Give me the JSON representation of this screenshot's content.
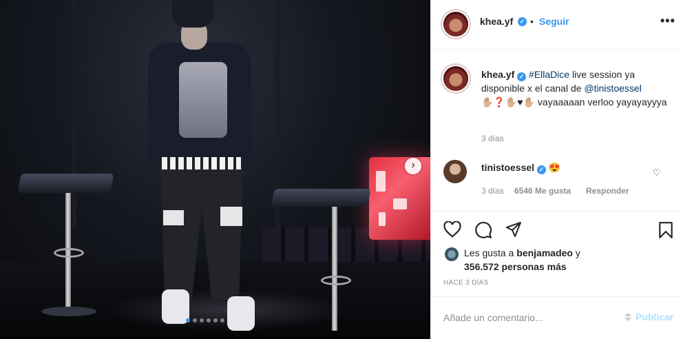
{
  "post": {
    "author": "khea.yf",
    "follow_label": "Seguir",
    "follow_separator": "•",
    "more_icon": "more-options-icon",
    "caption": {
      "author": "khea.yf",
      "hashtag": "#EllaDice",
      "text_1": " live session ya disponible x el canal de ",
      "mention": "@tinistoessel",
      "emojis": "✋🏼❓✋🏼♥✋🏼",
      "text_2": " vayaaaaan verloo yayayayyya"
    },
    "caption_time": "3 días",
    "comment": {
      "user": "tinistoessel",
      "emoji": "😍",
      "time": "3 días",
      "likes": "6546 Me gusta",
      "reply_label": "Responder"
    },
    "likes": {
      "prefix": "Les gusta a ",
      "first_user": "benjamadeo",
      "connector": " y",
      "others": "356.572 personas más"
    },
    "time_ago": "HACE 3 DÍAS",
    "comment_box": {
      "placeholder": "Añade un comentario...",
      "publish_label": "Publicar"
    },
    "carousel": {
      "slide_count": 6,
      "active_index": 0
    }
  },
  "colors": {
    "link_blue": "#3897f0",
    "hashtag_blue": "#00376b",
    "muted": "#8e8e8e",
    "publish_disabled": "#b2dffc"
  }
}
